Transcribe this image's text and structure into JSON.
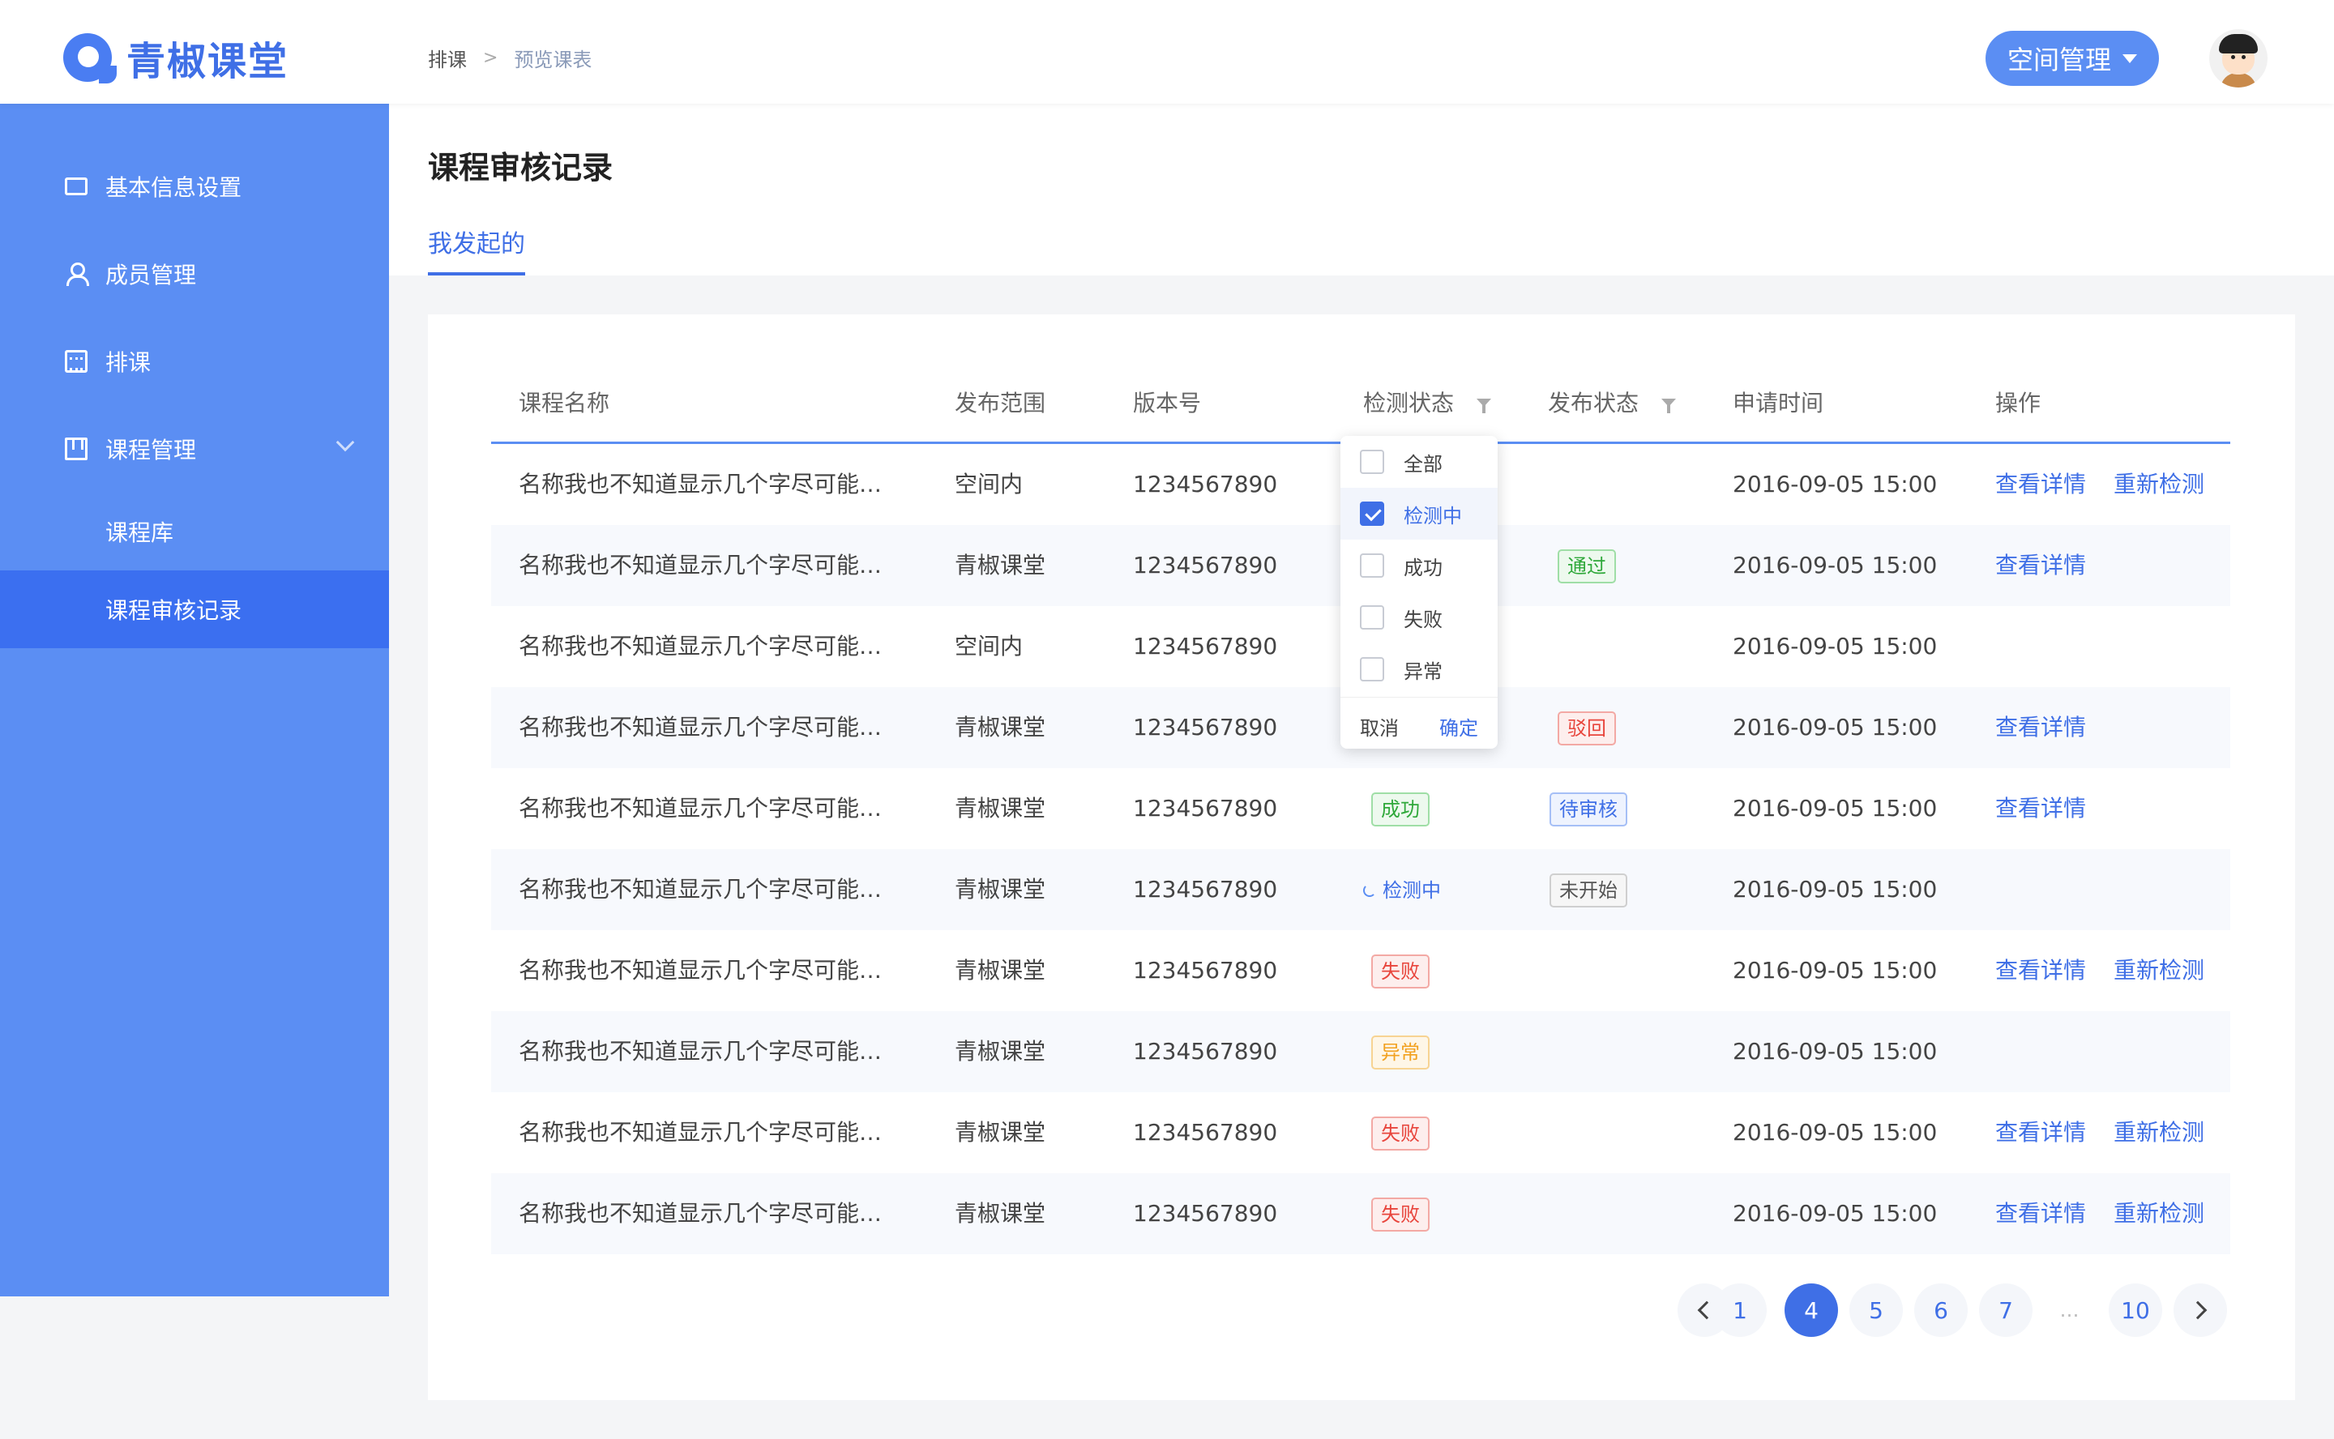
{
  "header": {
    "logo_text": "青椒课堂",
    "breadcrumb": [
      "排课",
      "预览课表"
    ],
    "space_button": "空间管理"
  },
  "sidebar": {
    "items": [
      {
        "label": "基本信息设置",
        "icon": "monitor-icon"
      },
      {
        "label": "成员管理",
        "icon": "user-icon"
      },
      {
        "label": "排课",
        "icon": "calendar-icon"
      },
      {
        "label": "课程管理",
        "icon": "book-icon"
      },
      {
        "label": "课程库",
        "icon": ""
      },
      {
        "label": "课程审核记录",
        "icon": ""
      }
    ]
  },
  "page": {
    "title": "课程审核记录",
    "tab": "我发起的"
  },
  "table": {
    "columns": [
      "课程名称",
      "发布范围",
      "版本号",
      "检测状态",
      "发布状态",
      "申请时间",
      "操作"
    ],
    "rows": [
      {
        "name": "名称我也不知道显示几个字尽可能…",
        "scope": "空间内",
        "version": "1234567890",
        "check": "",
        "publish": "",
        "time": "2016-09-05 15:00",
        "actions": [
          "查看详情",
          "重新检测"
        ]
      },
      {
        "name": "名称我也不知道显示几个字尽可能…",
        "scope": "青椒课堂",
        "version": "1234567890",
        "check": "",
        "publish": "通过",
        "time": "2016-09-05 15:00",
        "actions": [
          "查看详情"
        ]
      },
      {
        "name": "名称我也不知道显示几个字尽可能…",
        "scope": "空间内",
        "version": "1234567890",
        "check": "",
        "publish": "",
        "time": "2016-09-05 15:00",
        "actions": []
      },
      {
        "name": "名称我也不知道显示几个字尽可能…",
        "scope": "青椒课堂",
        "version": "1234567890",
        "check": "",
        "publish": "驳回",
        "time": "2016-09-05 15:00",
        "actions": [
          "查看详情"
        ]
      },
      {
        "name": "名称我也不知道显示几个字尽可能…",
        "scope": "青椒课堂",
        "version": "1234567890",
        "check": "成功",
        "publish": "待审核",
        "time": "2016-09-05 15:00",
        "actions": [
          "查看详情"
        ]
      },
      {
        "name": "名称我也不知道显示几个字尽可能…",
        "scope": "青椒课堂",
        "version": "1234567890",
        "check": "检测中",
        "publish": "未开始",
        "time": "2016-09-05 15:00",
        "actions": []
      },
      {
        "name": "名称我也不知道显示几个字尽可能…",
        "scope": "青椒课堂",
        "version": "1234567890",
        "check": "失败",
        "publish": "",
        "time": "2016-09-05 15:00",
        "actions": [
          "查看详情",
          "重新检测"
        ]
      },
      {
        "name": "名称我也不知道显示几个字尽可能…",
        "scope": "青椒课堂",
        "version": "1234567890",
        "check": "异常",
        "publish": "",
        "time": "2016-09-05 15:00",
        "actions": []
      },
      {
        "name": "名称我也不知道显示几个字尽可能…",
        "scope": "青椒课堂",
        "version": "1234567890",
        "check": "失败",
        "publish": "",
        "time": "2016-09-05 15:00",
        "actions": [
          "查看详情",
          "重新检测"
        ]
      },
      {
        "name": "名称我也不知道显示几个字尽可能…",
        "scope": "青椒课堂",
        "version": "1234567890",
        "check": "失败",
        "publish": "",
        "time": "2016-09-05 15:00",
        "actions": [
          "查看详情",
          "重新检测"
        ]
      }
    ]
  },
  "filter_dropdown": {
    "options": [
      {
        "label": "全部",
        "checked": false
      },
      {
        "label": "检测中",
        "checked": true
      },
      {
        "label": "成功",
        "checked": false
      },
      {
        "label": "失败",
        "checked": false
      },
      {
        "label": "异常",
        "checked": false
      }
    ],
    "cancel": "取消",
    "confirm": "确定"
  },
  "pagination": {
    "pages": [
      "1",
      "…",
      "4",
      "5",
      "6",
      "7",
      "…",
      "10"
    ],
    "current": "4"
  },
  "colors": {
    "primary": "#3f6fe6",
    "sidebar": "#5b8ef3",
    "sidebar_active": "#3b6ff0",
    "success": "#2fa83a",
    "danger": "#e8453c",
    "warning": "#f2a120"
  }
}
